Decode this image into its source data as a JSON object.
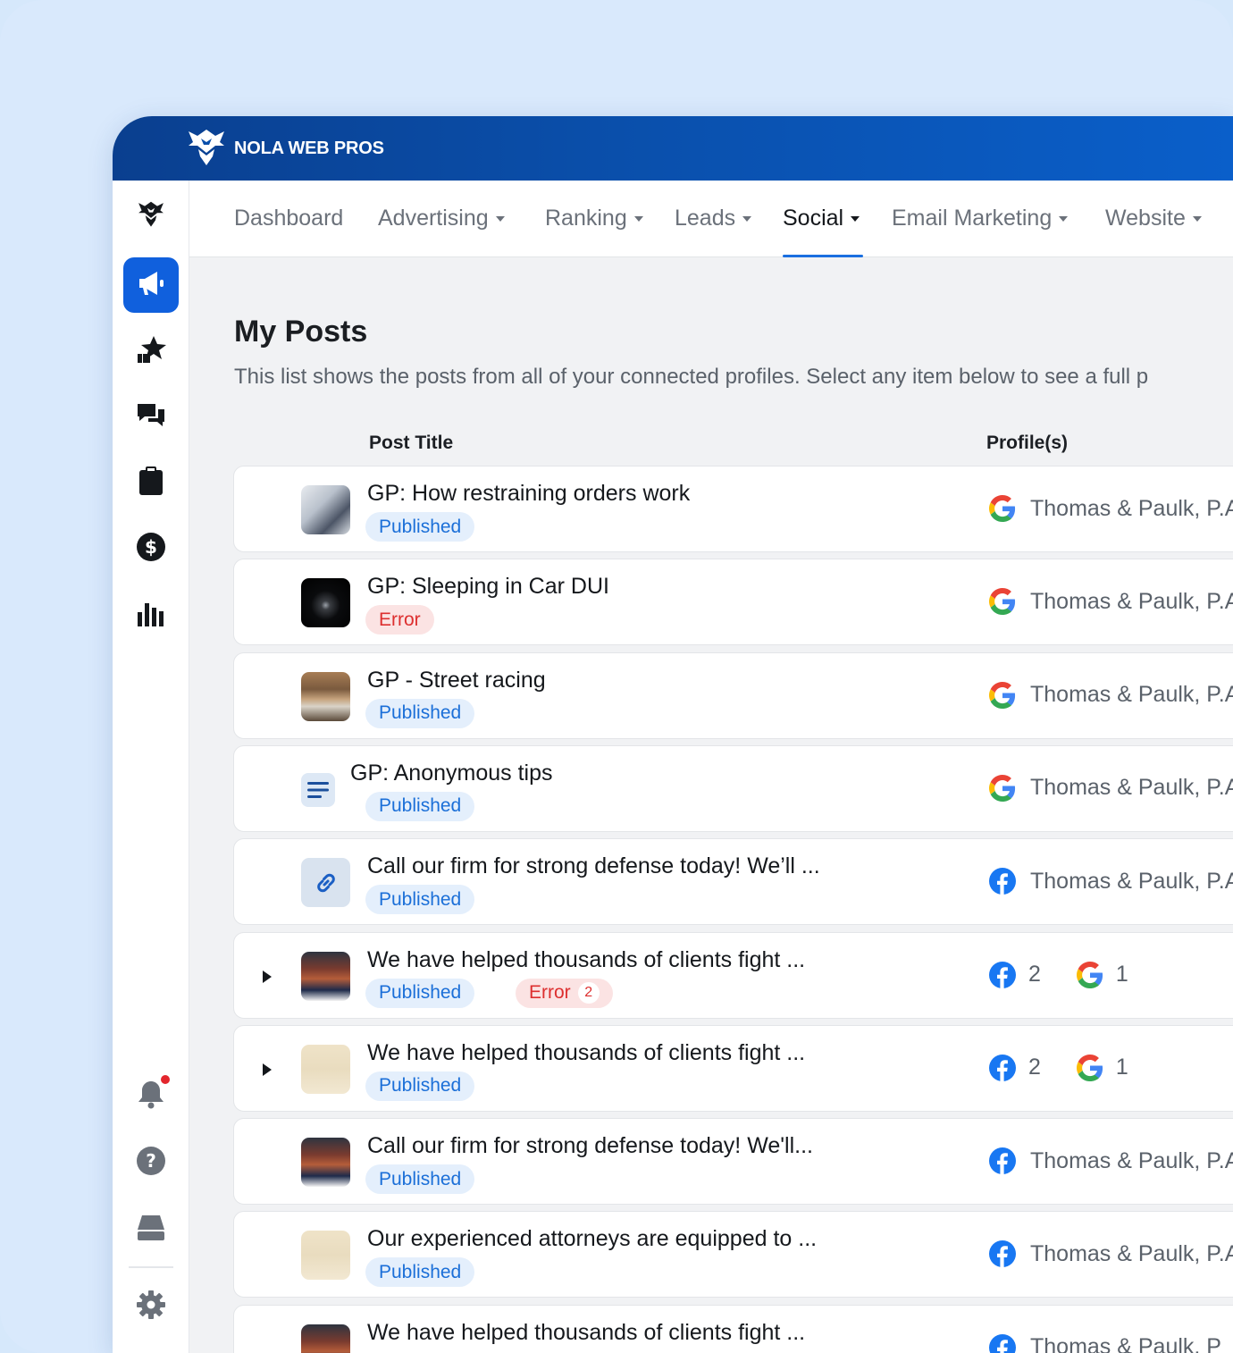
{
  "brand": {
    "name": "NOLA WEB PROS"
  },
  "colors": {
    "primary": "#1060dd",
    "topbar": "#0a4fab",
    "published_bg": "#e4effc",
    "published_text": "#1b6fd8",
    "error_bg": "#fbe3e3",
    "error_text": "#dd2f2f"
  },
  "sidebar": {
    "items": [
      {
        "icon": "logo-icon"
      },
      {
        "icon": "megaphone-icon",
        "active": true
      },
      {
        "icon": "star-thumb-icon"
      },
      {
        "icon": "chat-icon"
      },
      {
        "icon": "clipboard-icon"
      },
      {
        "icon": "dollar-icon"
      },
      {
        "icon": "bar-chart-icon"
      }
    ],
    "bottom": [
      {
        "icon": "bell-icon",
        "notification": true
      },
      {
        "icon": "help-icon"
      },
      {
        "icon": "inbox-tray-icon"
      },
      {
        "icon": "gear-icon"
      }
    ]
  },
  "nav": {
    "tabs": [
      {
        "label": "Dashboard",
        "dropdown": false
      },
      {
        "label": "Advertising",
        "dropdown": true
      },
      {
        "label": "Ranking",
        "dropdown": true
      },
      {
        "label": "Leads",
        "dropdown": true
      },
      {
        "label": "Social",
        "dropdown": true,
        "active": true
      },
      {
        "label": "Email Marketing",
        "dropdown": true
      },
      {
        "label": "Website",
        "dropdown": true
      }
    ]
  },
  "page": {
    "title": "My Posts",
    "subtitle": "This list shows the posts from all of your connected profiles. Select any item below to see a full p"
  },
  "table": {
    "headers": {
      "post_title": "Post Title",
      "profiles": "Profile(s)"
    },
    "rows": [
      {
        "title": "GP: How restraining orders work",
        "thumb": "photo-icon",
        "badges": [
          {
            "label": "Published",
            "type": "published"
          }
        ],
        "profiles": [
          {
            "network": "google",
            "name": "Thomas & Paulk, P.A"
          }
        ]
      },
      {
        "title": "GP: Sleeping in Car DUI",
        "thumb": "photo-icon",
        "badges": [
          {
            "label": "Error",
            "type": "error"
          }
        ],
        "profiles": [
          {
            "network": "google",
            "name": "Thomas & Paulk, P.A"
          }
        ]
      },
      {
        "title": "GP - Street racing",
        "thumb": "photo-icon",
        "badges": [
          {
            "label": "Published",
            "type": "published"
          }
        ],
        "profiles": [
          {
            "network": "google",
            "name": "Thomas & Paulk, P.A"
          }
        ]
      },
      {
        "title": "GP: Anonymous tips",
        "thumb": "text-post-icon",
        "badges": [
          {
            "label": "Published",
            "type": "published"
          }
        ],
        "profiles": [
          {
            "network": "google",
            "name": "Thomas & Paulk, P.A"
          }
        ]
      },
      {
        "title": "Call our firm for strong defense today! We’ll ...",
        "thumb": "link-icon",
        "badges": [
          {
            "label": "Published",
            "type": "published"
          }
        ],
        "profiles": [
          {
            "network": "facebook",
            "name": "Thomas & Paulk, P.A"
          }
        ]
      },
      {
        "title": "We have helped thousands of clients fight ...",
        "thumb": "photo-icon",
        "expandable": true,
        "badges": [
          {
            "label": "Published",
            "type": "published"
          },
          {
            "label": "Error",
            "type": "error",
            "count": "2"
          }
        ],
        "profile_counts": [
          {
            "network": "facebook",
            "count": "2"
          },
          {
            "network": "google",
            "count": "1"
          }
        ]
      },
      {
        "title": "We have helped thousands of clients fight ...",
        "thumb": "photo-icon",
        "expandable": true,
        "badges": [
          {
            "label": "Published",
            "type": "published"
          }
        ],
        "profile_counts": [
          {
            "network": "facebook",
            "count": "2"
          },
          {
            "network": "google",
            "count": "1"
          }
        ]
      },
      {
        "title": "Call our firm for strong defense today! We'll...",
        "thumb": "photo-icon",
        "badges": [
          {
            "label": "Published",
            "type": "published"
          }
        ],
        "profiles": [
          {
            "network": "facebook",
            "name": "Thomas & Paulk, P.A"
          }
        ]
      },
      {
        "title": "Our experienced attorneys are equipped to ...",
        "thumb": "photo-icon",
        "badges": [
          {
            "label": "Published",
            "type": "published"
          }
        ],
        "profiles": [
          {
            "network": "facebook",
            "name": "Thomas & Paulk, P.A"
          }
        ]
      },
      {
        "title": "We have helped thousands of clients fight ...",
        "thumb": "photo-icon",
        "badges": [],
        "profiles": [
          {
            "network": "facebook",
            "name": "Thomas & Paulk, P"
          }
        ]
      }
    ]
  }
}
